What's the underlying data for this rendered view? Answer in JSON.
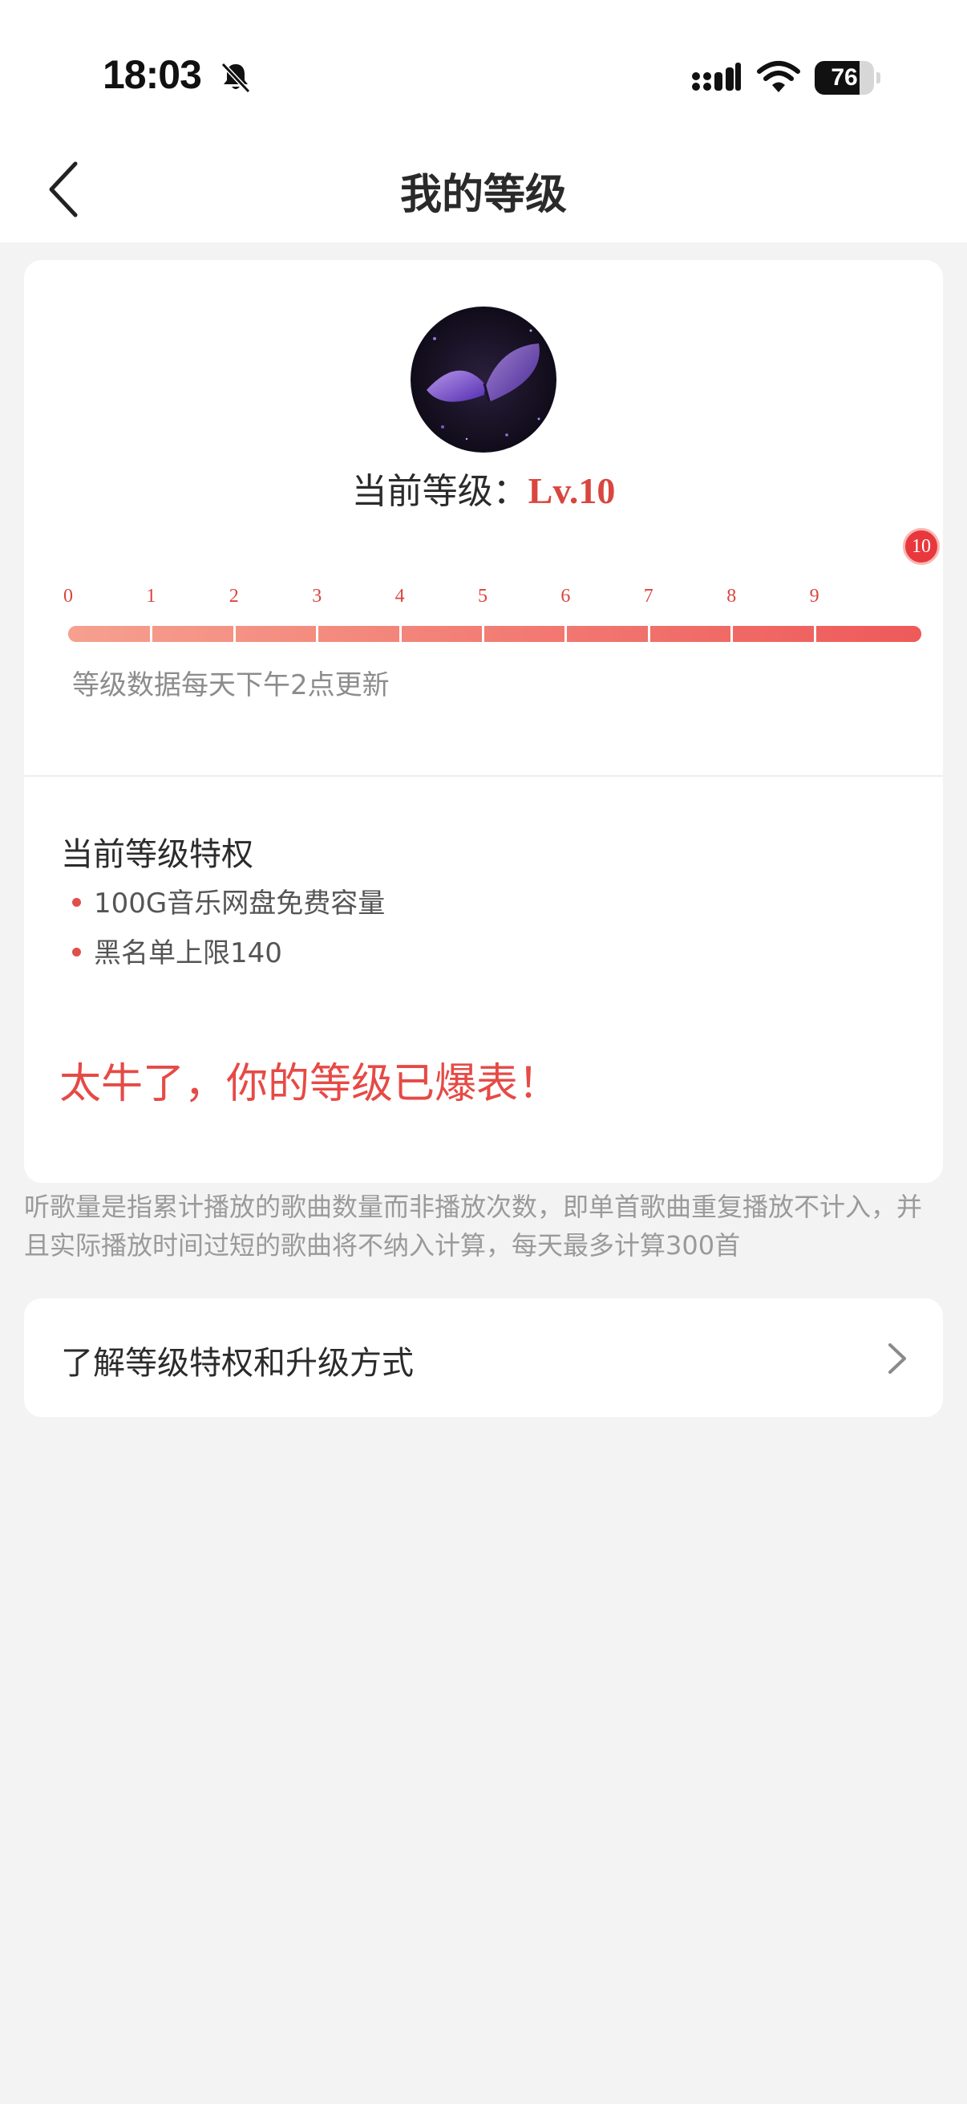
{
  "status_bar": {
    "time": "18:03",
    "battery": "76",
    "battery_level": 0.76,
    "icons": [
      "bell-slash-icon",
      "signal-icon",
      "wifi-icon",
      "battery-icon"
    ]
  },
  "nav": {
    "title": "我的等级",
    "back_icon": "chevron-left-icon"
  },
  "level": {
    "label": "当前等级：",
    "value": "Lv.10",
    "current": 10,
    "max": 10,
    "ticks": [
      "0",
      "1",
      "2",
      "3",
      "4",
      "5",
      "6",
      "7",
      "8",
      "9"
    ],
    "current_tick": "10",
    "update_note": "等级数据每天下午2点更新"
  },
  "privileges": {
    "title": "当前等级特权",
    "items": [
      "100G音乐网盘免费容量",
      "黑名单上限140"
    ]
  },
  "celebrate": "太牛了，你的等级已爆表！",
  "explain_note": "听歌量是指累计播放的歌曲数量而非播放次数，即单首歌曲重复播放不计入，并且实际播放时间过短的歌曲将不纳入计算，每天最多计算300首",
  "upgrade": {
    "label": "了解等级特权和升级方式",
    "icon": "chevron-right-icon"
  },
  "colors": {
    "accent": "#e64a46",
    "progress_start": "#f6a08f",
    "progress_end": "#ee5a5a",
    "background": "#f3f3f3"
  }
}
